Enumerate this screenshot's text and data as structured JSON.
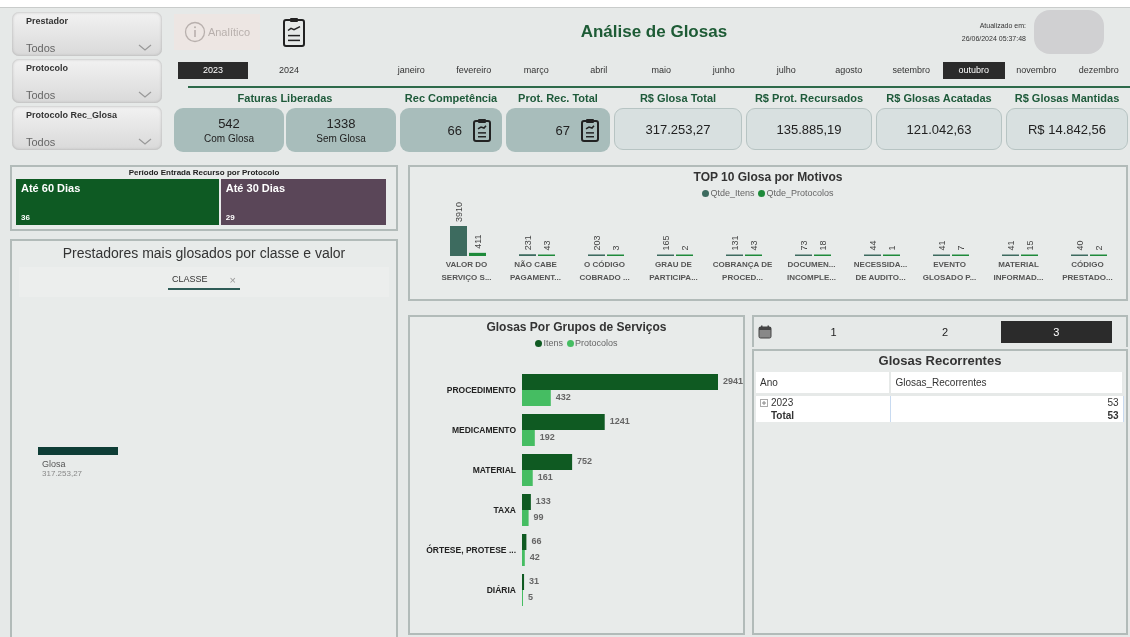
{
  "filters": [
    {
      "label": "Prestador",
      "value": "Todos"
    },
    {
      "label": "Protocolo",
      "value": "Todos"
    },
    {
      "label": "Protocolo Rec_Glosa",
      "value": "Todos"
    }
  ],
  "header": {
    "analitico_button": {
      "label": "Analítico",
      "disabled": true
    },
    "title": "Análise de Glosas",
    "updated_label": "Atualizado em:",
    "updated_value": "26/06/2024 05:37:48"
  },
  "years": [
    {
      "label": "2023",
      "selected": true
    },
    {
      "label": "2024",
      "selected": false
    }
  ],
  "months": [
    {
      "label": "janeiro",
      "selected": false
    },
    {
      "label": "fevereiro",
      "selected": false
    },
    {
      "label": "março",
      "selected": false
    },
    {
      "label": "abril",
      "selected": false
    },
    {
      "label": "maio",
      "selected": false
    },
    {
      "label": "junho",
      "selected": false
    },
    {
      "label": "julho",
      "selected": false
    },
    {
      "label": "agosto",
      "selected": false
    },
    {
      "label": "setembro",
      "selected": false
    },
    {
      "label": "outubro",
      "selected": true
    },
    {
      "label": "novembro",
      "selected": false
    },
    {
      "label": "dezembro",
      "selected": false
    }
  ],
  "kpis": [
    {
      "title": "Faturas Liberadas",
      "kind": "split",
      "cards": [
        {
          "value": "542",
          "label": "Com Glosa"
        },
        {
          "value": "1338",
          "label": "Sem Glosa"
        }
      ]
    },
    {
      "title": "Rec Competência",
      "kind": "icon",
      "cards": [
        {
          "value": "66"
        }
      ]
    },
    {
      "title": "Prot. Rec. Total",
      "kind": "icon",
      "cards": [
        {
          "value": "67"
        }
      ]
    },
    {
      "title": "R$ Glosa Total",
      "kind": "plain",
      "cards": [
        {
          "value": "317.253,27"
        }
      ]
    },
    {
      "title": "R$ Prot. Recursados",
      "kind": "plain",
      "cards": [
        {
          "value": "135.885,19"
        }
      ]
    },
    {
      "title": "R$ Glosas Acatadas",
      "kind": "plain",
      "cards": [
        {
          "value": "121.042,63"
        }
      ]
    },
    {
      "title": "R$ Glosas Mantidas",
      "kind": "plain",
      "cards": [
        {
          "value": "R$ 14.842,56"
        }
      ]
    }
  ],
  "periodo": {
    "title": "Período Entrada Recurso por Protocolo",
    "items": [
      {
        "label": "Até 60 Dias",
        "value": "36",
        "color": "#0e5a23"
      },
      {
        "label": "Até 30 Dias",
        "value": "29",
        "color": "#5a4658"
      }
    ]
  },
  "prestadores": {
    "title": "Prestadores mais glosados por classe e valor",
    "column_header": "CLASSE",
    "close": "×",
    "node": {
      "label": "Glosa",
      "value": "317.253,27"
    }
  },
  "top10": {
    "chart_data": {
      "type": "bar",
      "title": "TOP 10 Glosa por Motivos",
      "legend": "top",
      "categories": [
        "VALOR DO SERVIÇO S...",
        "NÃO CABE PAGAMENT...",
        "O CÓDIGO COBRADO ...",
        "GRAU DE PARTICIPA...",
        "COBRANÇA DE PROCED...",
        "DOCUMEN... INCOMPLE...",
        "NECESSIDA... DE AUDITO...",
        "EVENTO GLOSADO P...",
        "MATERIAL INFORMAD...",
        "CÓDIGO PRESTADO..."
      ],
      "data_labels": true,
      "series": [
        {
          "name": "Qtde_Itens",
          "color": "#3d6b5f",
          "values": [
            3910,
            231,
            203,
            165,
            131,
            73,
            44,
            41,
            41,
            40
          ]
        },
        {
          "name": "Qtde_Protocolos",
          "color": "#1e8a3a",
          "values": [
            411,
            43,
            3,
            2,
            43,
            18,
            1,
            7,
            15,
            2
          ]
        }
      ]
    }
  },
  "grupos": {
    "chart_data": {
      "type": "bar",
      "orientation": "horizontal",
      "title": "Glosas Por Grupos de Serviços",
      "legend": "top",
      "categories": [
        "PROCEDIMENTO",
        "MEDICAMENTO",
        "MATERIAL",
        "TAXA",
        "ÓRTESE, PROTESE ...",
        "DIÁRIA"
      ],
      "data_labels": true,
      "series": [
        {
          "name": "Itens",
          "color": "#0f5a22",
          "values": [
            2941,
            1241,
            752,
            133,
            66,
            31
          ]
        },
        {
          "name": "Protocolos",
          "color": "#45bd62",
          "values": [
            432,
            192,
            161,
            99,
            42,
            5
          ]
        }
      ]
    }
  },
  "pages": [
    {
      "label": "1",
      "selected": false
    },
    {
      "label": "2",
      "selected": false
    },
    {
      "label": "3",
      "selected": true
    }
  ],
  "recorrentes": {
    "title": "Glosas Recorrentes",
    "columns": [
      "Ano",
      "Glosas_Recorrentes"
    ],
    "rows": [
      {
        "kind": "year",
        "expanded": false,
        "cells": [
          "2023",
          "53"
        ]
      },
      {
        "kind": "total",
        "cells": [
          "Total",
          "53"
        ]
      }
    ]
  }
}
